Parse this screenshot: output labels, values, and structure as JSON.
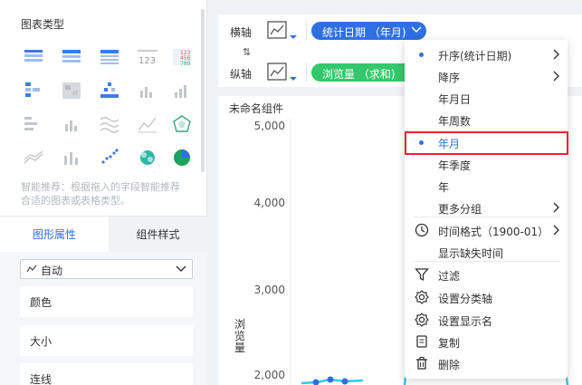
{
  "left_panel": {
    "title": "图表类型",
    "smart_tip": "智能推荐：根据拖入的字段智能推荐合适的图表或表格类型。",
    "chart_types": [
      {
        "icon": "table-icon"
      },
      {
        "icon": "cross-table-icon"
      },
      {
        "icon": "detail-table-icon"
      },
      {
        "icon": "kpi-number-icon"
      },
      {
        "icon": "colored-table-icon"
      },
      {
        "icon": "pivot-list-icon"
      },
      {
        "icon": "heatmap-table-icon"
      },
      {
        "icon": "stacked-bar-icon"
      },
      {
        "icon": "small-bar-icon"
      },
      {
        "icon": "grouped-bar-icon"
      },
      {
        "icon": "horizontal-bar-icon"
      },
      {
        "icon": "mini-column-icon"
      },
      {
        "icon": "wave-line-icon"
      },
      {
        "icon": "line-chart-icon"
      },
      {
        "icon": "radar-icon"
      },
      {
        "icon": "area-line-icon"
      },
      {
        "icon": "column-mixed-icon"
      },
      {
        "icon": "scatter-icon"
      },
      {
        "icon": "bubble-icon"
      },
      {
        "icon": "pie-icon"
      }
    ],
    "tabs": {
      "shape_props": "图形属性",
      "widget_style": "组件样式"
    },
    "auto_select": "自动",
    "properties": [
      "颜色",
      "大小",
      "连线"
    ]
  },
  "axis_panel": {
    "x_label": "横轴",
    "y_label": "纵轴",
    "x_field": "统计日期 （年月)",
    "y_field": "浏览量 （求和)",
    "swap_label": "⇅"
  },
  "chart": {
    "widget_title": "未命名组件",
    "ylabel": "浏览量",
    "y_ticks": [
      "5,000",
      "4,000",
      "3,000",
      "2,000"
    ]
  },
  "menu": {
    "items": [
      {
        "label": "升序(统计日期)",
        "dot": true,
        "arrow": true,
        "icon": ""
      },
      {
        "label": "降序",
        "dot": false,
        "arrow": true,
        "icon": ""
      },
      {
        "label": "年月日",
        "dot": false,
        "arrow": false,
        "icon": ""
      },
      {
        "label": "年周数",
        "dot": false,
        "arrow": false,
        "icon": ""
      },
      {
        "label": "年月",
        "dot": true,
        "arrow": false,
        "icon": "",
        "selected": true
      },
      {
        "label": "年季度",
        "dot": false,
        "arrow": false,
        "icon": ""
      },
      {
        "label": "年",
        "dot": false,
        "arrow": false,
        "icon": ""
      },
      {
        "label": "更多分组",
        "dot": false,
        "arrow": true,
        "icon": ""
      },
      {
        "label": "时间格式（1900-01）",
        "dot": false,
        "arrow": true,
        "icon": "clock-icon"
      },
      {
        "label": "显示缺失时间",
        "dot": false,
        "arrow": false,
        "icon": ""
      },
      {
        "label": "过滤",
        "dot": false,
        "arrow": false,
        "icon": "filter-icon"
      },
      {
        "label": "设置分类轴",
        "dot": false,
        "arrow": false,
        "icon": "gear-icon"
      },
      {
        "label": "设置显示名",
        "dot": false,
        "arrow": false,
        "icon": "gear-icon"
      },
      {
        "label": "复制",
        "dot": false,
        "arrow": false,
        "icon": "copy-icon"
      },
      {
        "label": "删除",
        "dot": false,
        "arrow": false,
        "icon": "trash-icon"
      }
    ]
  },
  "colors": {
    "accent": "#2f6fe4",
    "green": "#32c86b",
    "cyan": "#35c8e8",
    "highlight": "#e5262d"
  }
}
